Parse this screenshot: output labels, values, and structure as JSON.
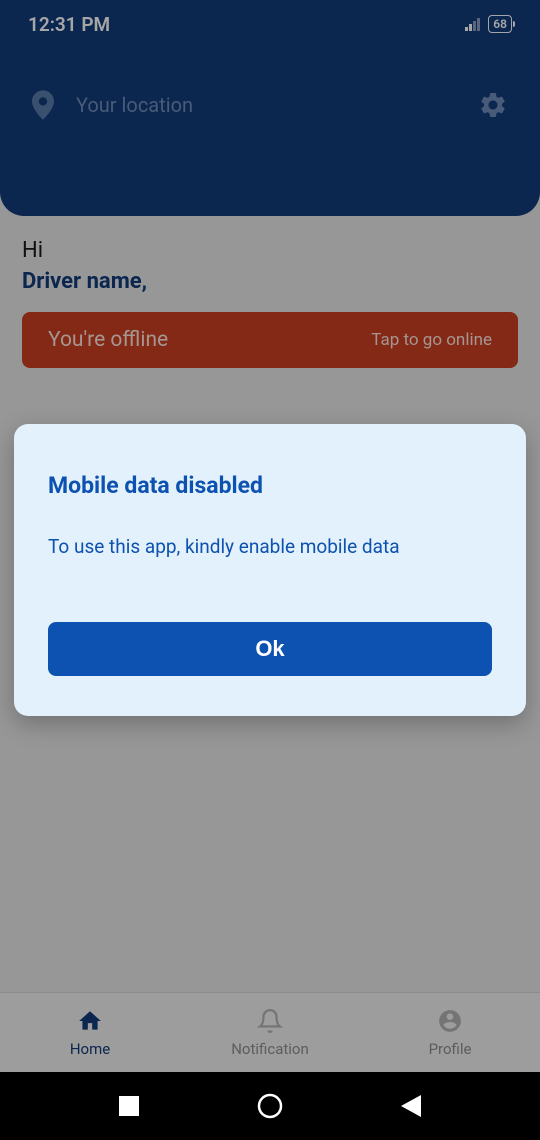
{
  "status": {
    "time": "12:31 PM",
    "battery": "68"
  },
  "header": {
    "location_placeholder": "Your location"
  },
  "greeting": {
    "hi": "Hi",
    "name": "Driver name,"
  },
  "offline": {
    "status": "You're offline",
    "action": "Tap to go online"
  },
  "dialog": {
    "title": "Mobile data disabled",
    "message": "To use this app, kindly enable mobile data",
    "ok": "Ok"
  },
  "nav": {
    "home": "Home",
    "notification": "Notification",
    "profile": "Profile"
  }
}
